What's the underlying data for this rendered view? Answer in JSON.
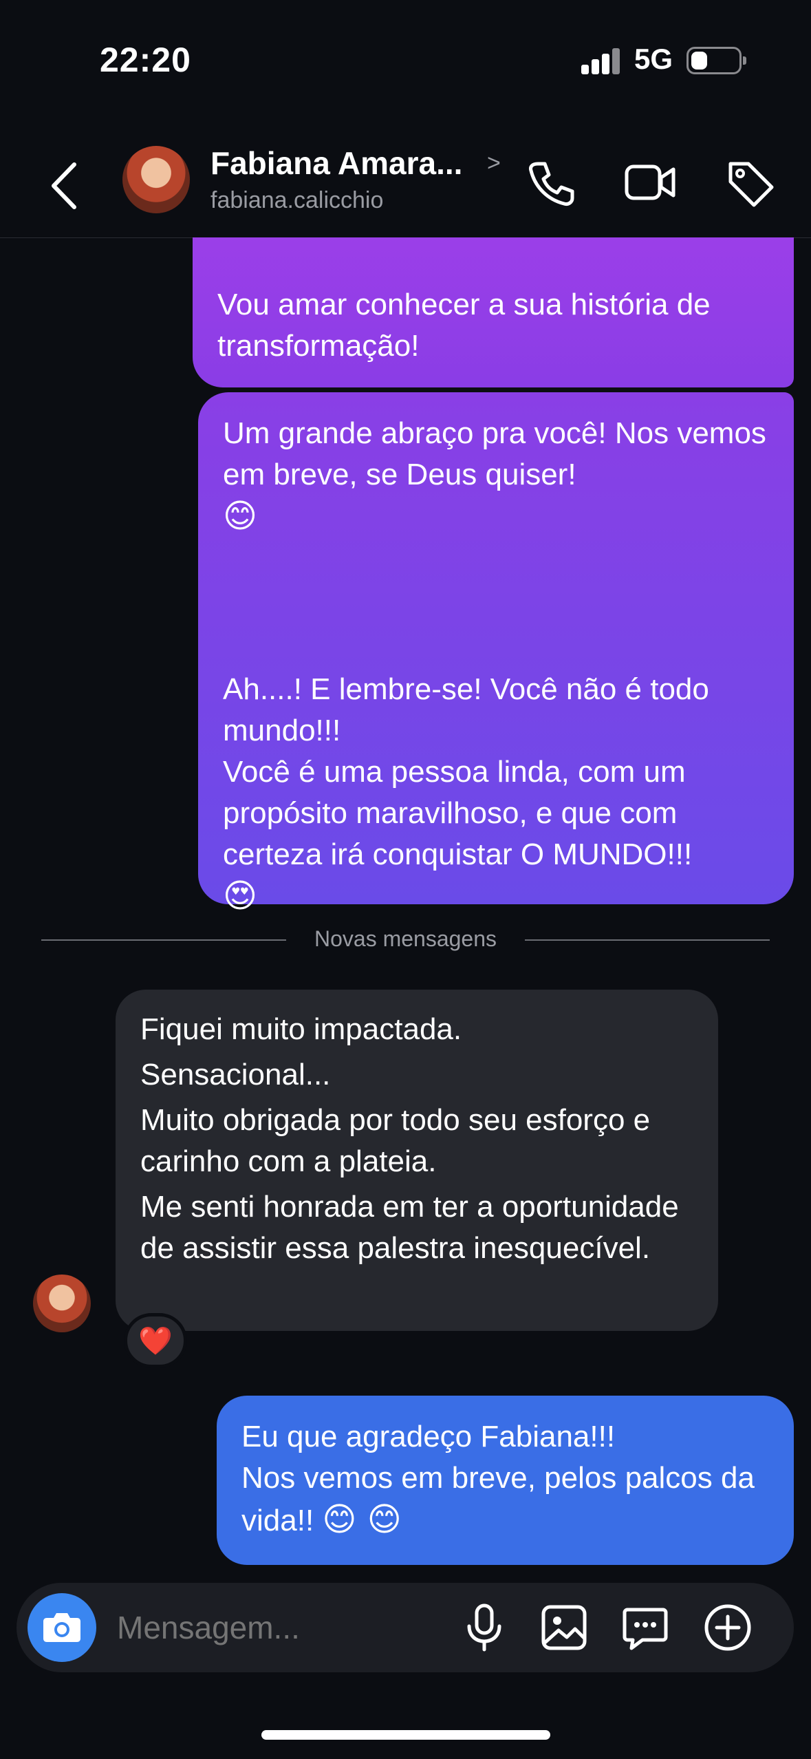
{
  "status_bar": {
    "time": "22:20",
    "network": "5G",
    "battery_level": 0.35
  },
  "header": {
    "contact_name": "Fabiana Amara...",
    "contact_handle": "fabiana.calicchio",
    "chevron": ">",
    "icons": [
      "back-icon",
      "phone-icon",
      "video-icon",
      "tag-icon"
    ]
  },
  "messages": {
    "sent_1": {
      "text": "Vou amar conhecer a sua história de transformação!"
    },
    "sent_2": {
      "line1": "Um grande abraço pra você! Nos vemos em breve, se Deus quiser!",
      "emoji1": "😊",
      "line2": "Ah....! E lembre-se! Você não é todo mundo!!!",
      "line3": "Você é uma pessoa linda, com um propósito maravilhoso, e que com certeza irá conquistar O MUNDO!!!",
      "emoji2": "😍"
    },
    "divider_label": "Novas mensagens",
    "received": {
      "line1": "Fiquei muito impactada.",
      "line2": "Sensacional...",
      "line3": "Muito obrigada por todo seu esforço e carinho com a plateia.",
      "line4": "Me senti honrada em ter a oportunidade de assistir essa palestra inesquecível.",
      "reaction": "❤️"
    },
    "sent_3": {
      "line1": "Eu que agradeço Fabiana!!!",
      "line2": "Nos vemos em breve, pelos palcos da vida!!",
      "emoji": "😊 😊"
    }
  },
  "composer": {
    "placeholder": "Mensagem...",
    "icons": [
      "camera-icon",
      "microphone-icon",
      "image-icon",
      "sticker-icon",
      "plus-icon"
    ]
  },
  "colors": {
    "background": "#0b0d12",
    "sent_purple": "#8a3de6",
    "sent_blue": "#3a6ee6",
    "received_gray": "#26282e",
    "camera_blue": "#3a86f0"
  }
}
